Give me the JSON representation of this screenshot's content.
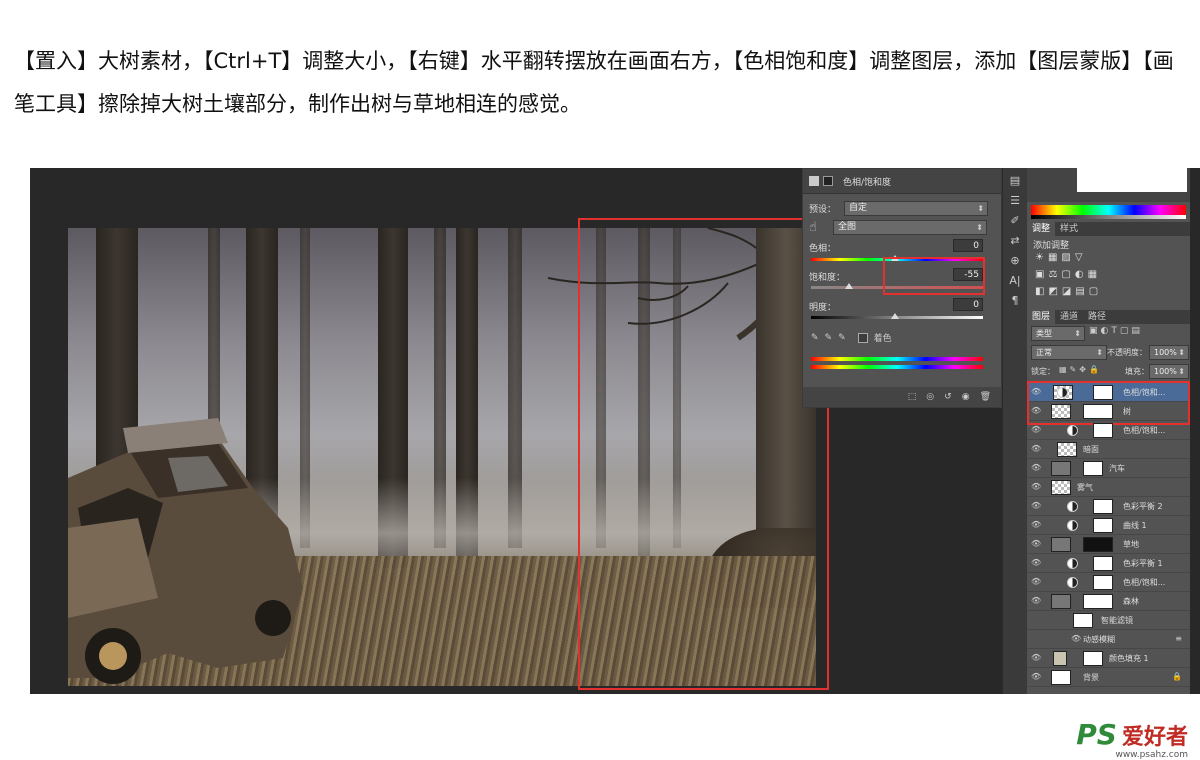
{
  "instruction": "【置入】大树素材，【Ctrl+T】调整大小，【右键】水平翻转摆放在画面右方，【色相饱和度】调整图层，添加【图层蒙版】【画笔工具】擦除掉大树土壤部分，制作出树与草地相连的感觉。",
  "properties": {
    "title": "色相/饱和度",
    "preset_label": "预设：",
    "preset_value": "自定",
    "channel_value": "全图",
    "hue_label": "色相：",
    "hue_value": "0",
    "saturation_label": "饱和度：",
    "saturation_value": "-55",
    "lightness_label": "明度：",
    "lightness_value": "0",
    "colorize_label": "着色"
  },
  "adjustments": {
    "tabs": [
      "调整",
      "样式"
    ],
    "add_label": "添加调整"
  },
  "layers_panel": {
    "tabs": [
      "图层",
      "通道",
      "路径"
    ],
    "filter_kind": "类型",
    "blend_mode": "正常",
    "opacity_label": "不透明度：",
    "opacity_value": "100%",
    "lock_label": "锁定：",
    "fill_label": "填充：",
    "fill_value": "100%",
    "layers": [
      "色相/饱和...",
      "树",
      "色相/饱和...",
      "暗面",
      "汽车",
      "雾气",
      "色彩平衡 2",
      "曲线 1",
      "草地",
      "色彩平衡 1",
      "色相/饱和...",
      "森林",
      "智能滤镜",
      "动感模糊",
      "颜色填充 1",
      "背景"
    ]
  },
  "watermark": {
    "logo": "PS",
    "text": "爱好者",
    "url": "www.psahz.com"
  },
  "colors": {
    "highlight": "#e2312f",
    "selected_layer": "#4a6b98"
  }
}
